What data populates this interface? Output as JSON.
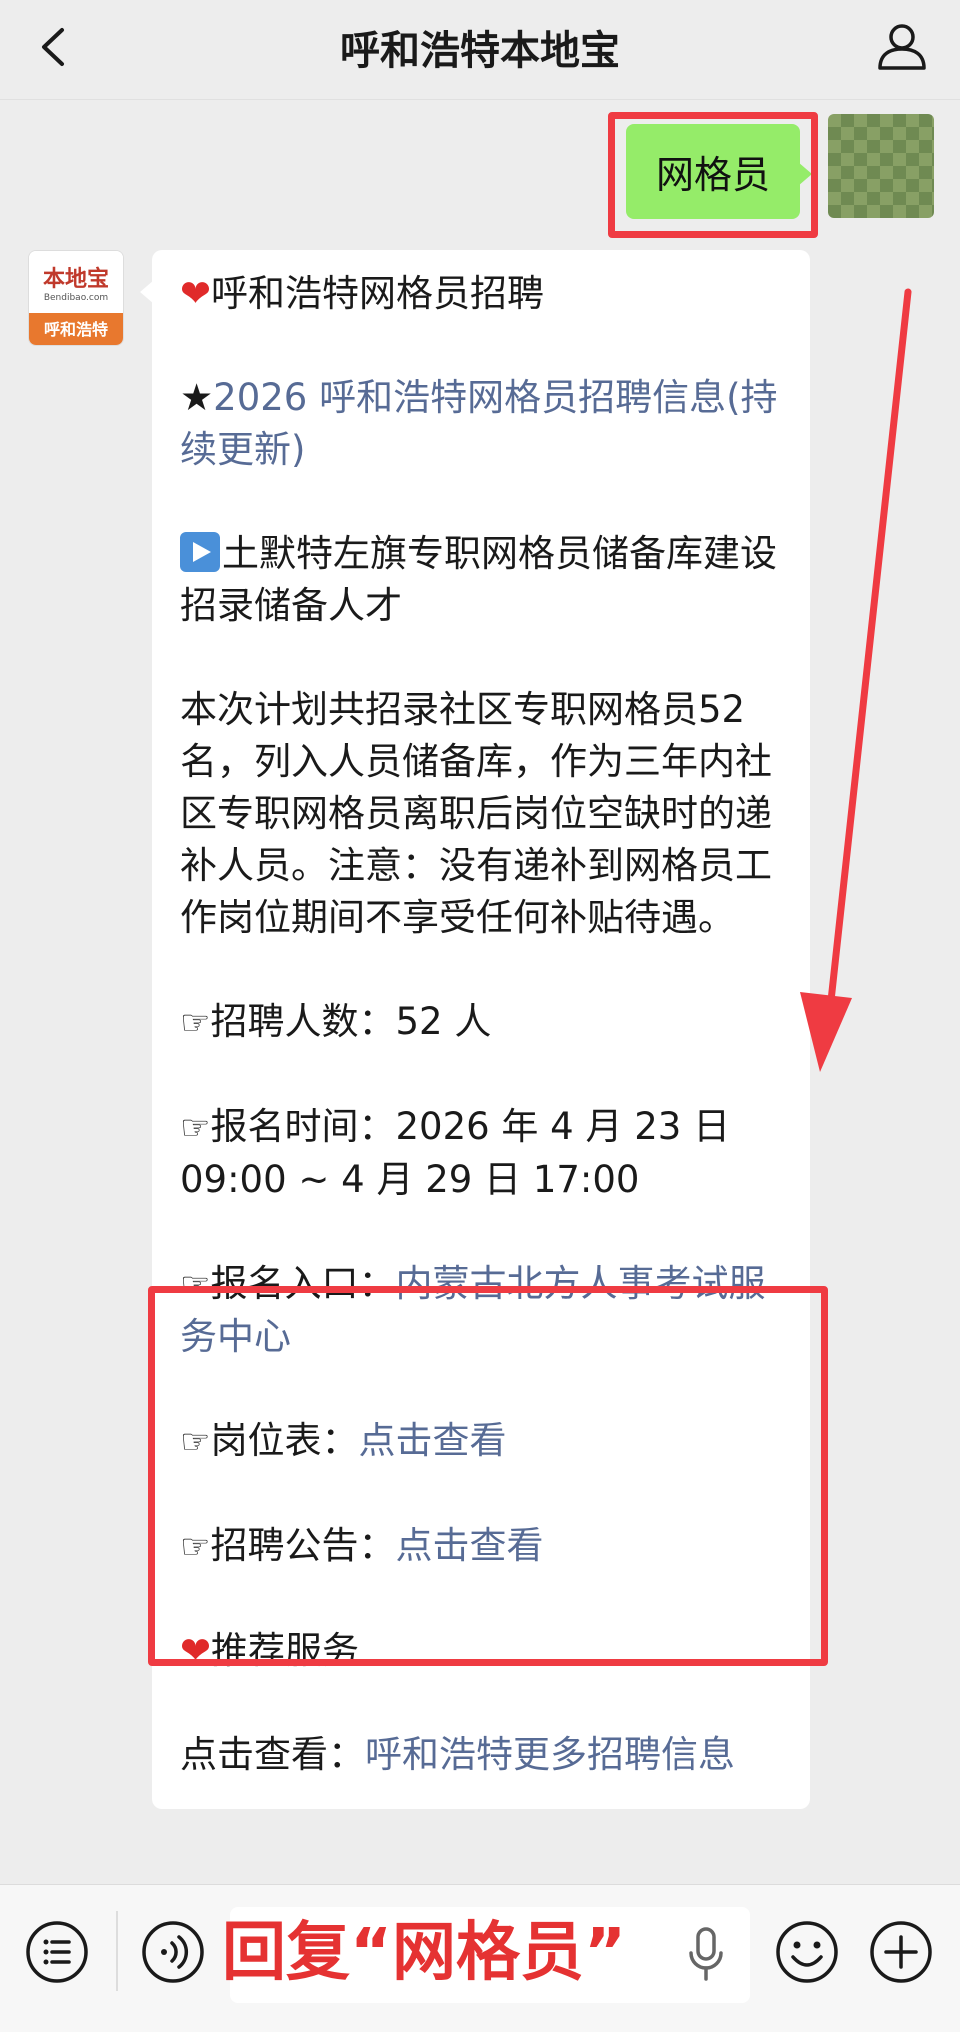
{
  "header": {
    "title": "呼和浩特本地宝",
    "back_icon": "chevron-left-icon",
    "profile_icon": "person-icon"
  },
  "user_message": {
    "text": "网格员"
  },
  "bot_avatar": {
    "logo_text": "本地宝",
    "logo_sub": "Bendibao.com",
    "city_label": "呼和浩特"
  },
  "bot_message": {
    "title": "呼和浩特网格员招聘",
    "item1_star": "★",
    "item1_link": "2026 呼和浩特网格员招聘信息(持续更新)",
    "item2": "土默特左旗专职网格员储备库建设招录储备人才",
    "desc": "本次计划共招录社区专职网格员52名，列入人员储备库，作为三年内社区专职网格员离职后岗位空缺时的递补人员。注意：没有递补到网格员工作岗位期间不享受任何补贴待遇。",
    "count_label": "招聘人数：",
    "count_value": "52 人",
    "time_label": "报名时间：",
    "time_value": "2026 年 4 月 23 日 09:00 ~ 4 月 29 日 17:00",
    "entry_label": "报名入口：",
    "entry_link": "内蒙古北方人事考试服务中心",
    "posts_label": "岗位表：",
    "posts_link": "点击查看",
    "notice_label": "招聘公告：",
    "notice_link": "点击查看",
    "service_title": "推荐服务",
    "more_label": "点击查看：",
    "more_link": "呼和浩特更多招聘信息",
    "heart": "❤",
    "hand": "☞"
  },
  "bottom": {
    "overlay_text": "回复“网格员”",
    "menu_icon": "list-menu-icon",
    "voice_icon": "voice-icon",
    "emoji_icon": "emoji-icon",
    "plus_icon": "plus-icon",
    "mic_icon": "mic-icon"
  },
  "colors": {
    "link": "#576b95",
    "user_bubble": "#95ec69",
    "highlight": "#ef3b42"
  }
}
